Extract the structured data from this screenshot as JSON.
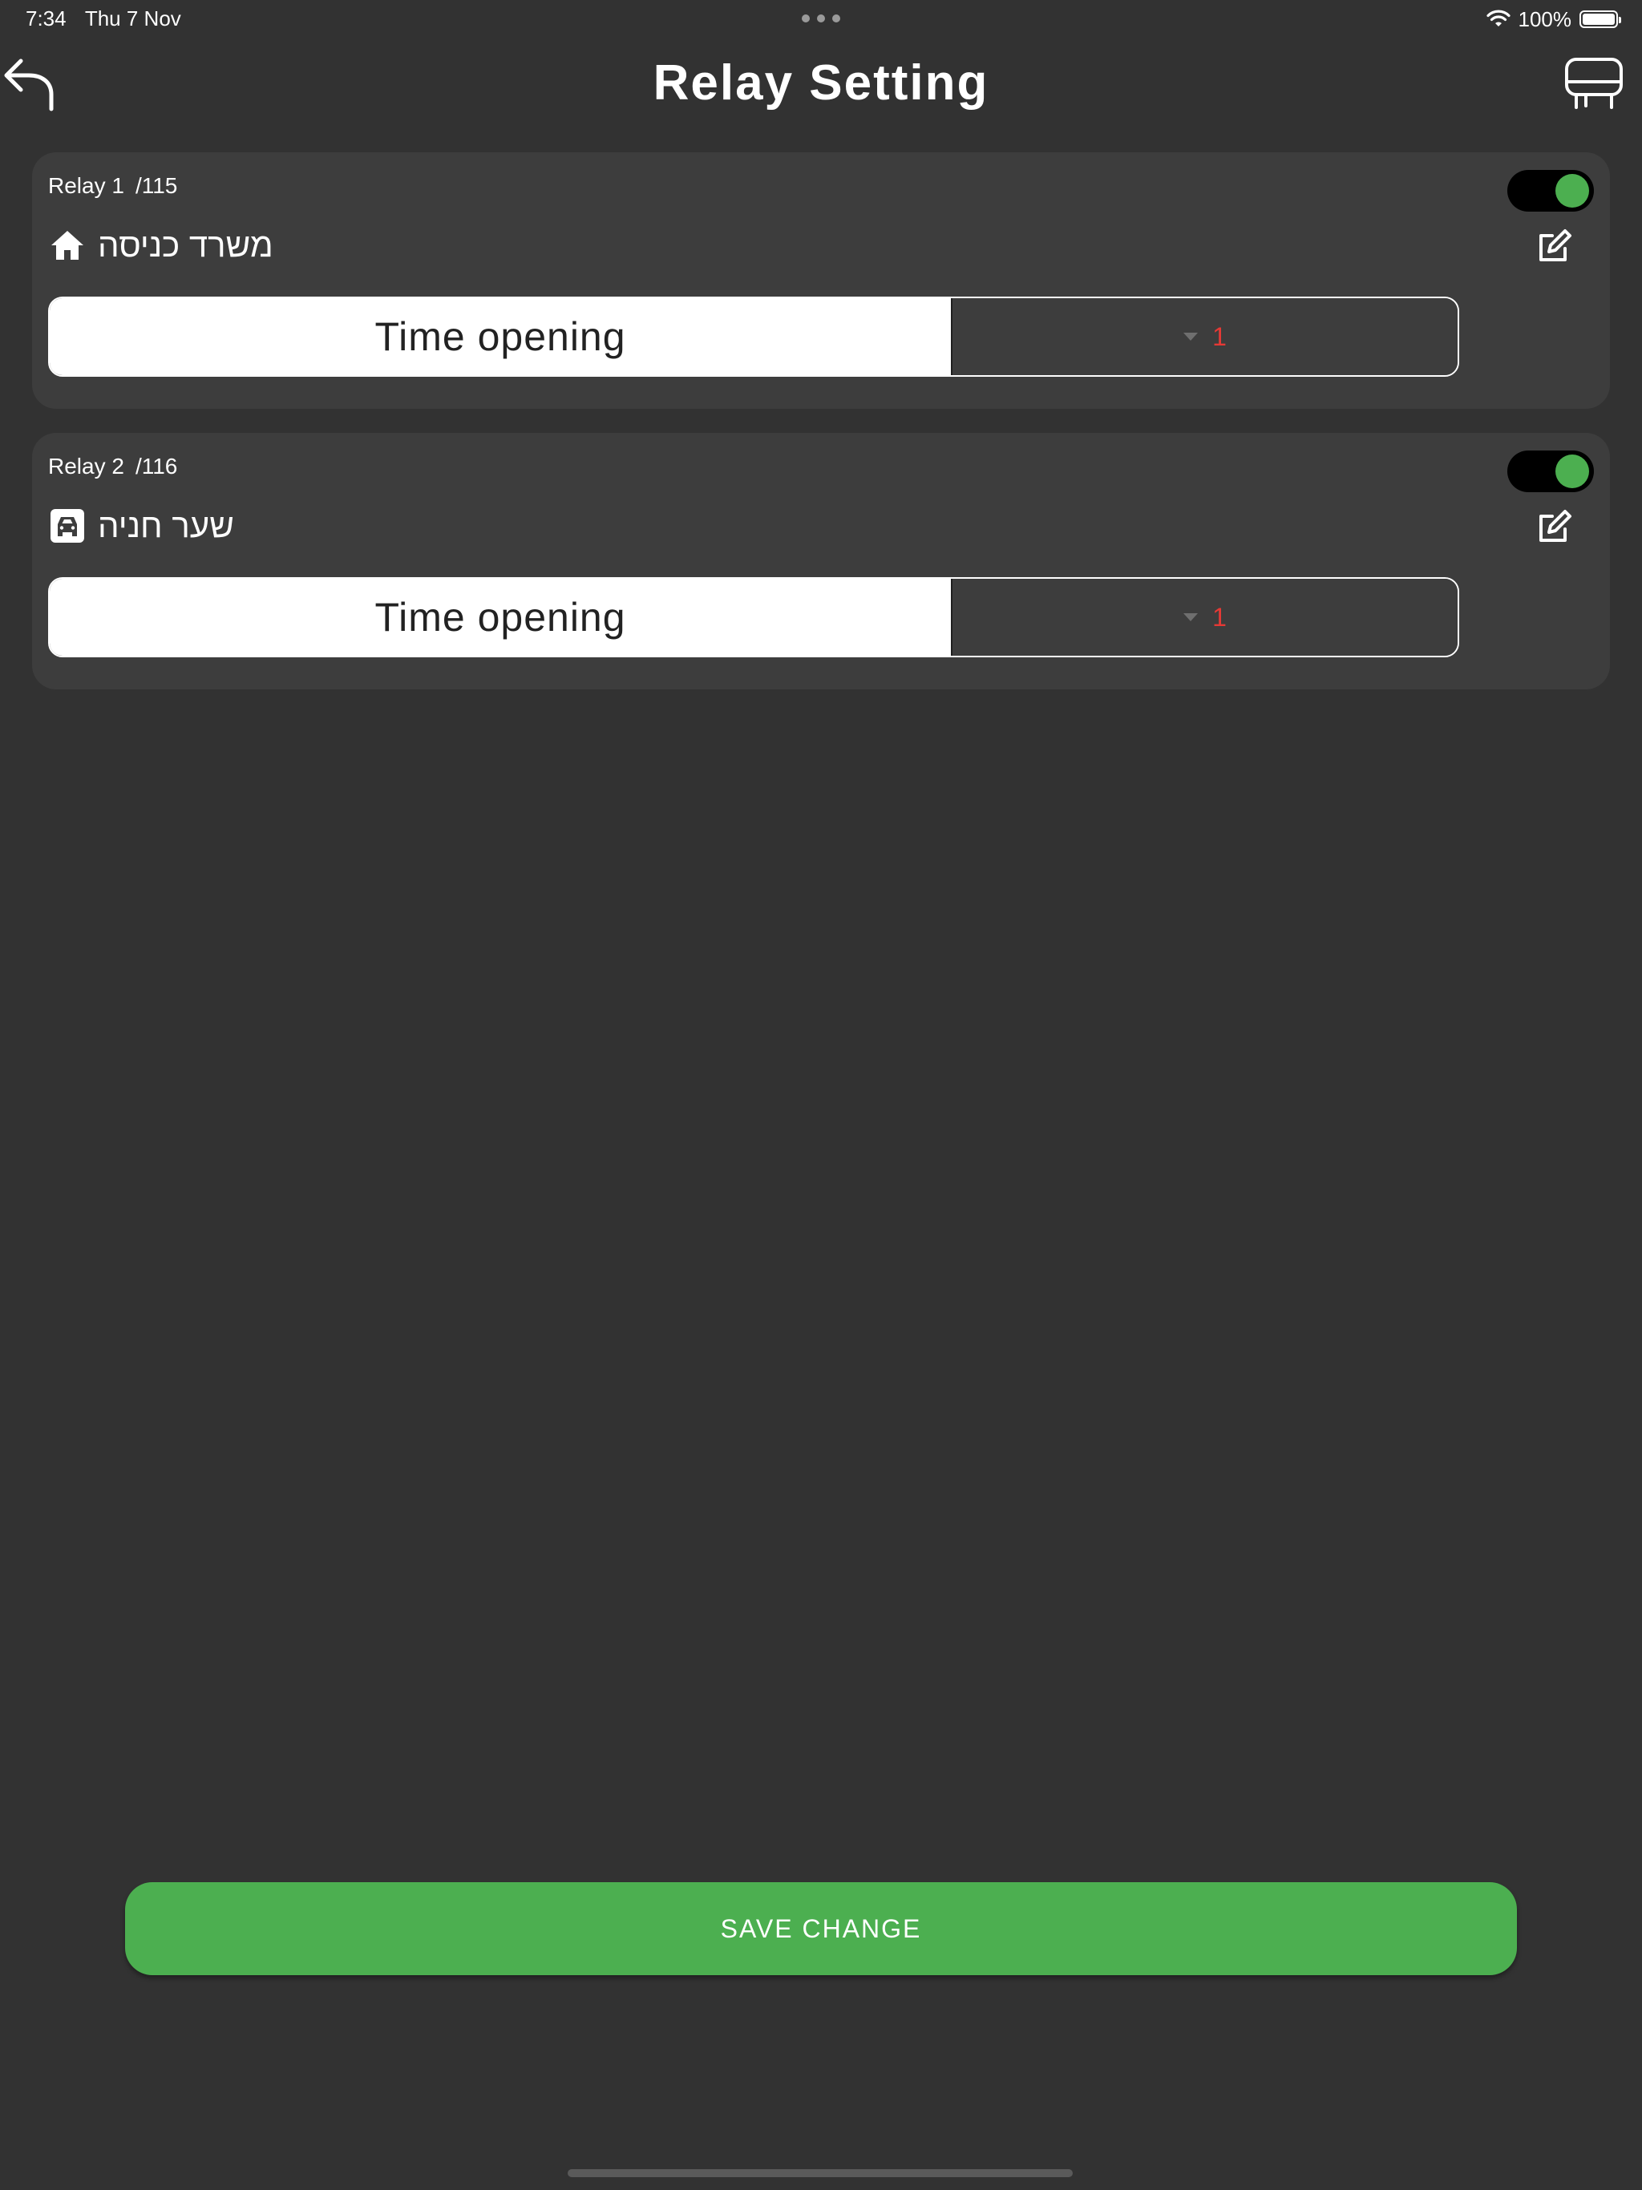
{
  "status_bar": {
    "time": "7:34",
    "date": "Thu 7 Nov",
    "battery_percent": "100%"
  },
  "header": {
    "title": "Relay Setting"
  },
  "relays": [
    {
      "label": "Relay 1",
      "number": "/115",
      "name": "משרד כניסה",
      "icon": "home-icon",
      "enabled": true,
      "time_label": "Time opening",
      "time_value": "1"
    },
    {
      "label": "Relay 2",
      "number": "/116",
      "name": "שער חניה",
      "icon": "car-icon",
      "enabled": true,
      "time_label": "Time opening",
      "time_value": "1"
    }
  ],
  "footer": {
    "save_label": "SAVE CHANGE"
  },
  "colors": {
    "background": "#323232",
    "card": "#3d3d3d",
    "accent_green": "#4caf50",
    "value_red": "#e53935"
  }
}
